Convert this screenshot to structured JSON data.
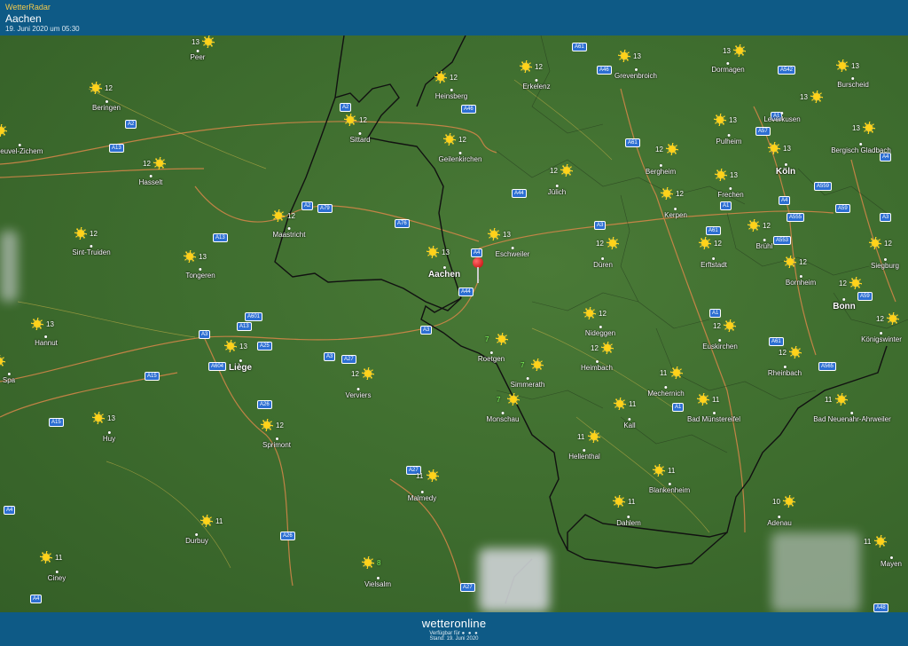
{
  "header": {
    "app_title": "WetterRadar",
    "place": "Aachen",
    "timestamp": "19. Juni 2020 um 05:30"
  },
  "footer": {
    "brand": "wetteronline",
    "available": "Verfügbar für",
    "dots": "● ● ●",
    "stand": "Stand: 19. Juni 2020"
  },
  "colors": {
    "header_bg": "#0e5a86",
    "map_green": "#3f6e2f",
    "sun": "#ffd21a",
    "road_badge": "#2d6fd2"
  },
  "cities": [
    {
      "name": "Peer",
      "temp": "13"
    },
    {
      "name": "Beringen",
      "temp": "12"
    },
    {
      "name": "heuvel-Zichem",
      "temp": ""
    },
    {
      "name": "Hasselt",
      "temp": "12"
    },
    {
      "name": "Sint-Truiden",
      "temp": "12"
    },
    {
      "name": "Tongeren",
      "temp": "13"
    },
    {
      "name": "Hannut",
      "temp": "13"
    },
    {
      "name": "Huy",
      "temp": "13"
    },
    {
      "name": "Liège",
      "temp": "13"
    },
    {
      "name": "Durbuy",
      "temp": "11"
    },
    {
      "name": "Ciney",
      "temp": "11"
    },
    {
      "name": "Maastricht",
      "temp": "12"
    },
    {
      "name": "Sittard",
      "temp": "12"
    },
    {
      "name": "Heinsberg",
      "temp": "12"
    },
    {
      "name": "Geilenkirchen",
      "temp": "12"
    },
    {
      "name": "Aachen",
      "temp": "13"
    },
    {
      "name": "Eschweiler",
      "temp": "13"
    },
    {
      "name": "Erkelenz",
      "temp": "12"
    },
    {
      "name": "Grevenbroich",
      "temp": "13"
    },
    {
      "name": "Dormagen",
      "temp": "13"
    },
    {
      "name": "Burscheid",
      "temp": "13"
    },
    {
      "name": "Leverkusen",
      "temp": "13"
    },
    {
      "name": "Bergisch Gladbach",
      "temp": "13"
    },
    {
      "name": "Pulheim",
      "temp": "13"
    },
    {
      "name": "Köln",
      "temp": "13"
    },
    {
      "name": "Bergheim",
      "temp": "12"
    },
    {
      "name": "Jülich",
      "temp": "12"
    },
    {
      "name": "Frechen",
      "temp": "13"
    },
    {
      "name": "Kerpen",
      "temp": "12"
    },
    {
      "name": "Düren",
      "temp": "12"
    },
    {
      "name": "Erftstadt",
      "temp": "12"
    },
    {
      "name": "Brühl",
      "temp": "12"
    },
    {
      "name": "Siegburg",
      "temp": "12"
    },
    {
      "name": "Bornheim",
      "temp": "12"
    },
    {
      "name": "Bonn",
      "temp": "12"
    },
    {
      "name": "Königswinter",
      "temp": "12"
    },
    {
      "name": "Euskirchen",
      "temp": "12"
    },
    {
      "name": "Rheinbach",
      "temp": "12"
    },
    {
      "name": "Nideggen",
      "temp": "12"
    },
    {
      "name": "Heimbach",
      "temp": "12"
    },
    {
      "name": "Mechernich",
      "temp": "11"
    },
    {
      "name": "Bad Münstereifel",
      "temp": "11"
    },
    {
      "name": "Bad Neuenahr-Ahrweiler",
      "temp": "11"
    },
    {
      "name": "Roetgen",
      "temp": "7"
    },
    {
      "name": "Simmerath",
      "temp": "7"
    },
    {
      "name": "Monschau",
      "temp": "7"
    },
    {
      "name": "Kall",
      "temp": "11"
    },
    {
      "name": "Hellenthal",
      "temp": "11"
    },
    {
      "name": "Blankenheim",
      "temp": "11"
    },
    {
      "name": "Dahlem",
      "temp": "11"
    },
    {
      "name": "Adenau",
      "temp": "10"
    },
    {
      "name": "Mayen",
      "temp": "11"
    },
    {
      "name": "Verviers",
      "temp": "12"
    },
    {
      "name": "Spa",
      "temp": ""
    },
    {
      "name": "Sprimont",
      "temp": "12"
    },
    {
      "name": "Malmedy",
      "temp": "11"
    },
    {
      "name": "Vielsalm",
      "temp": "8"
    }
  ],
  "roads": [
    "A2",
    "A13",
    "A2",
    "A13",
    "A2",
    "A76",
    "A79",
    "A13",
    "A601",
    "A3",
    "A25",
    "A3",
    "A27",
    "A604",
    "A15",
    "A26",
    "A26",
    "A27",
    "A4",
    "A15",
    "A4",
    "A27",
    "A44",
    "A4",
    "A44",
    "A3",
    "A46",
    "A61",
    "A46",
    "A542",
    "A1",
    "A57",
    "A61",
    "A1",
    "A4",
    "A559",
    "A59",
    "A61",
    "A555",
    "A553",
    "A59",
    "A3",
    "A1",
    "A565",
    "A61",
    "A1",
    "A48",
    "A4",
    "A3"
  ],
  "map_labels": {
    "marker": "Aachen"
  }
}
